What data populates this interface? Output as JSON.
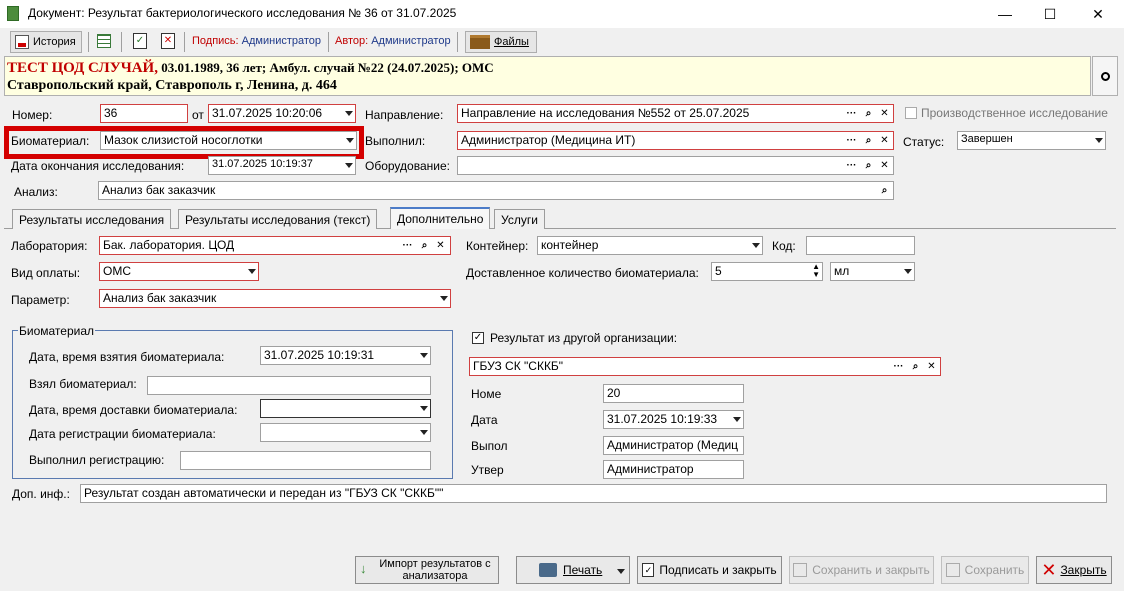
{
  "window": {
    "title": "Документ: Результат бактериологического исследования №  36 от 31.07.2025",
    "minimize": "—",
    "maximize": "☐",
    "close": "✕"
  },
  "toolbar": {
    "history": "История",
    "sign_label": "Подпись:",
    "sign_value": "Администратор",
    "author_label": "Автор:",
    "author_value": "Администратор",
    "files": "Файлы"
  },
  "header": {
    "patient": "ТЕСТ ЦОД СЛУЧАЙ,",
    "details": " 03.01.1989, 36 лет; Амбул. случай №22 (24.07.2025); ОМС",
    "address": "Ставропольский край, Ставрополь г, Ленина, д. 464"
  },
  "form": {
    "number_label": "Номер:",
    "number_value": "36",
    "from_label": "от",
    "from_value": "31.07.2025 10:20:06",
    "direction_label": "Направление:",
    "direction_value": "Направление на исследования №552 от 25.07.2025",
    "production_label": "Производственное исследование",
    "biomaterial_label": "Биоматериал:",
    "biomaterial_value": "Мазок слизистой носоглотки",
    "performed_label": "Выполнил:",
    "performed_value": "Администратор (Медицина ИТ)",
    "status_label": "Статус:",
    "status_value": "Завершен",
    "end_date_label": "Дата окончания исследования:",
    "end_date_value": "31.07.2025 10:19:37",
    "equipment_label": "Оборудование:",
    "equipment_value": "",
    "analysis_label": "Анализ:",
    "analysis_value": "Анализ бак заказчик"
  },
  "tabs": [
    {
      "label": "Результаты исследования"
    },
    {
      "label": "Результаты исследования (текст)"
    },
    {
      "label": "Дополнительно"
    },
    {
      "label": "Услуги"
    }
  ],
  "extra": {
    "lab_label": "Лаборатория:",
    "lab_value": "Бак. лаборатория. ЦОД",
    "container_label": "Контейнер:",
    "container_value": "контейнер",
    "code_label": "Код:",
    "code_value": "",
    "payment_label": "Вид оплаты:",
    "payment_value": "ОМС",
    "qty_label": "Доставленное количество биоматериала:",
    "qty_value": "5",
    "unit_value": "мл",
    "param_label": "Параметр:",
    "param_value": "Анализ бак заказчик",
    "group_title": "Биоматериал",
    "take_date_label": "Дата, время взятия биоматериала:",
    "take_date_value": "31.07.2025 10:19:31",
    "took_label": "Взял биоматериал:",
    "took_value": "",
    "delivery_label": "Дата, время доставки биоматериала:",
    "delivery_value": "",
    "reg_date_label": "Дата регистрации биоматериала:",
    "reg_date_value": "",
    "reg_by_label": "Выполнил регистрацию:",
    "reg_by_value": "",
    "other_org_label": "Результат из другой организации:",
    "other_org_value": "ГБУЗ СК \"СККБ\"",
    "nom_label": "Номе",
    "nom_value": "20",
    "date_label": "Дата",
    "date_value": "31.07.2025 10:19:33",
    "perf_label": "Выпол",
    "perf_value": "Администратор (Медиц",
    "appr_label": "Утвер",
    "appr_value": "Администратор",
    "addinfo_label": "Доп. инф.:",
    "addinfo_value": "Результат создан автоматически и передан из \"ГБУЗ СК \"СККБ\"\""
  },
  "buttons": {
    "import": "Импорт результатов с анализатора",
    "print": "Печать",
    "sign_close": "Подписать и закрыть",
    "save_close": "Сохранить и закрыть",
    "save": "Сохранить",
    "close": "Закрыть"
  },
  "colors": {
    "highlight_frame": "#d40000",
    "header_bg": "#ffffe1",
    "patient_name": "#c00000",
    "link_text": "#1f3a8a"
  }
}
